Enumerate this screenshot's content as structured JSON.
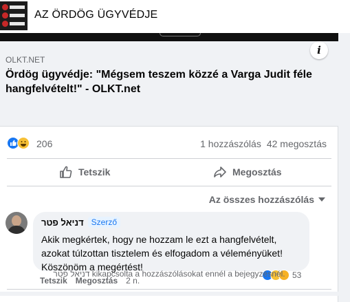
{
  "page": {
    "name": "AZ ÖRDÖG ÜGYVÉDJE",
    "avatar_rows": [
      "Orbá",
      "Fidesz",
      "KORI"
    ]
  },
  "link": {
    "domain": "OLKT.NET",
    "title": "Ördög ügyvédje: \"Mégsem teszem közzé a Varga Judit féle hangfelvételt!\" - OLKT.net",
    "info_icon": "i"
  },
  "stats": {
    "reaction_count": "206",
    "comments": "1 hozzászólás",
    "shares": "42 megosztás"
  },
  "actions": {
    "like": "Tetszik",
    "share": "Megosztás"
  },
  "sort": {
    "label": "Az összes hozzászólás"
  },
  "comment": {
    "author": "דניאל פטר",
    "badge": "Szerző",
    "text": "Akik megkértek, hogy ne hozzam le ezt a hangfelvételt, azokat túlzottan tisztelem és elfogadom a véleményüket! Köszönöm a megértést!",
    "like": "Tetszik",
    "share": "Megosztás",
    "time": "2 n.",
    "reaction_count": "53"
  },
  "closed_note": "דניאל פטר kikapcsolta a hozzászólásokat ennél a bejegyzésnél.",
  "colors": {
    "accent": "#1877f2",
    "muted": "#65676b",
    "background": "#f0f2f5"
  }
}
